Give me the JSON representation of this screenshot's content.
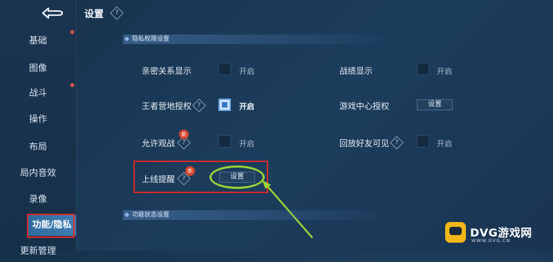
{
  "header": {
    "title": "设置"
  },
  "sidebar": {
    "items": [
      {
        "label": "基础"
      },
      {
        "label": "图像"
      },
      {
        "label": "战斗"
      },
      {
        "label": "操作"
      },
      {
        "label": "布局"
      },
      {
        "label": "局内音效"
      },
      {
        "label": "录像"
      },
      {
        "label": "功能/隐私"
      },
      {
        "label": "更新管理"
      }
    ],
    "active": "功能/隐私"
  },
  "sections": {
    "privacy": {
      "title": "隐私权限设置"
    },
    "status": {
      "title": "功能状态设置"
    }
  },
  "settings": {
    "intimacy": {
      "label": "亲密关系显示",
      "state": "开启"
    },
    "record": {
      "label": "战绩显示",
      "state": "开启"
    },
    "camp": {
      "label": "王者营地授权",
      "state": "开启"
    },
    "game_center": {
      "label": "游戏中心授权",
      "button": "设置"
    },
    "spectate": {
      "label": "允许观战",
      "state": "开启",
      "badge": "新"
    },
    "replay": {
      "label": "回放好友可见",
      "state": "开启"
    },
    "online_remind": {
      "label": "上线提醒",
      "button": "设置",
      "badge": "新"
    }
  },
  "help": {
    "glyph": "?"
  },
  "watermark": {
    "name": "DVG游戏网",
    "url": "WWW.DVG.CN"
  },
  "colors": {
    "highlight_box": "#e02828",
    "annotation": "#9bd337",
    "accent": "#3a78c2"
  }
}
